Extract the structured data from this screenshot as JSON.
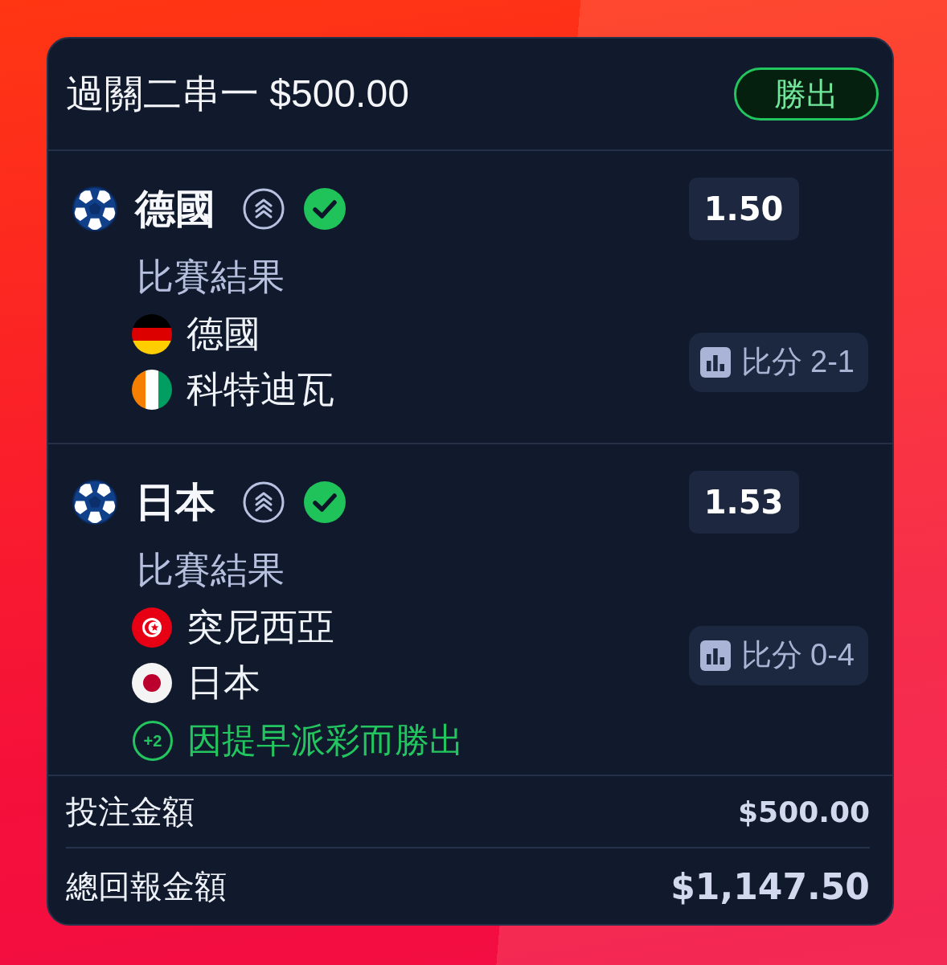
{
  "bet": {
    "title": "過關二串一 $500.00",
    "status": {
      "label": "勝出",
      "kind": "won"
    }
  },
  "legs": [
    {
      "selection": "德國",
      "boosted": true,
      "won": true,
      "odds": "1.50",
      "market": "比賽結果",
      "teams": [
        {
          "name": "德國",
          "kind": "germany"
        },
        {
          "name": "科特迪瓦",
          "kind": "ivorycoast"
        }
      ],
      "score": "比分 2-1"
    },
    {
      "selection": "日本",
      "boosted": true,
      "won": true,
      "odds": "1.53",
      "market": "比賽結果",
      "teams": [
        {
          "name": "突尼西亞",
          "kind": "tunisia"
        },
        {
          "name": "日本",
          "kind": "japan"
        }
      ],
      "score": "比分 0-4",
      "early_payout": {
        "badge": "+2",
        "text": "因提早派彩而勝出"
      }
    }
  ],
  "summary": [
    {
      "label": "投注金額",
      "value": "$500.00",
      "kind": "stake"
    },
    {
      "label": "總回報金額",
      "value": "$1,147.50",
      "kind": "total"
    }
  ]
}
